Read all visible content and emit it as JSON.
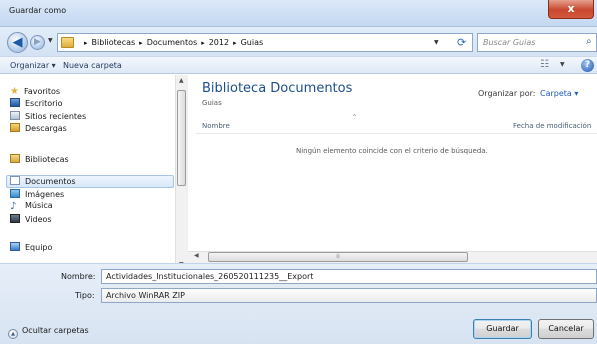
{
  "window": {
    "title": "Guardar como",
    "close_label": "x"
  },
  "address": {
    "crumbs": [
      "Bibliotecas",
      "Documentos",
      "2012",
      "Guias"
    ],
    "search_placeholder": "Buscar Guias"
  },
  "toolbar": {
    "organize": "Organizar ▾",
    "new_folder": "Nueva carpeta",
    "help": "?"
  },
  "sidebar": {
    "items": [
      {
        "label": "Favoritos",
        "icon": "star-icon"
      },
      {
        "label": "Escritorio",
        "icon": "desktop-icon"
      },
      {
        "label": "Sitios recientes",
        "icon": "recent-places-icon"
      },
      {
        "label": "Descargas",
        "icon": "downloads-icon"
      },
      {
        "label": "Bibliotecas",
        "icon": "libraries-icon"
      },
      {
        "label": "Documentos",
        "icon": "documents-icon"
      },
      {
        "label": "Imágenes",
        "icon": "pictures-icon"
      },
      {
        "label": "Música",
        "icon": "music-icon"
      },
      {
        "label": "Videos",
        "icon": "videos-icon"
      },
      {
        "label": "Equipo",
        "icon": "computer-icon"
      }
    ]
  },
  "content": {
    "library_title": "Biblioteca Documentos",
    "library_subtitle": "Guias",
    "arrange_label": "Organizar por:",
    "arrange_value": "Carpeta ▾",
    "col_name": "Nombre",
    "col_date": "Fecha de modificación",
    "empty_message": "Ningún elemento coincide con el criterio de búsqueda."
  },
  "form": {
    "name_label": "Nombre:",
    "name_value": "Actividades_Institucionales_260520111235__Export",
    "type_label": "Tipo:",
    "type_value": "Archivo WinRAR ZIP"
  },
  "footer": {
    "hide_folders": "Ocultar carpetas",
    "save": "Guardar",
    "cancel": "Cancelar"
  }
}
